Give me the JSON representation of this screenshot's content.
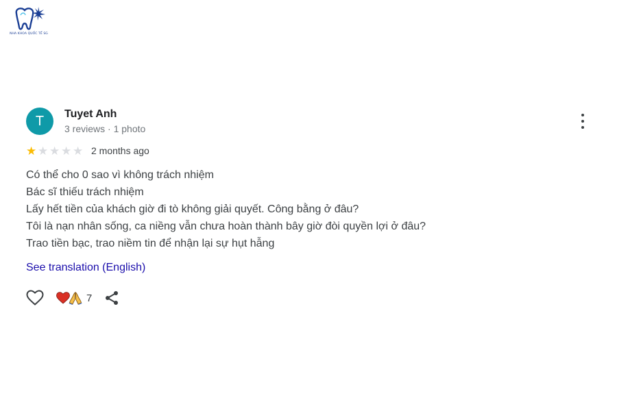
{
  "logo": {
    "text": "NHA KHOA QUỐC TẾ SG",
    "icon": "tooth-logo-icon"
  },
  "review": {
    "avatar_letter": "T",
    "author": "Tuyet Anh",
    "meta": "3 reviews · 1 photo",
    "rating": 1,
    "rating_max": 5,
    "time": "2 months ago",
    "lines": [
      "Có thể cho 0 sao vì không trách nhiệm",
      "Bác sĩ thiếu trách nhiệm",
      "Lấy hết tiền của khách giờ đi tò không giải quyết. Công bằng ở đâu?",
      "Tôi là nạn nhân sống, ca niềng vẫn chưa hoàn thành bây giờ đòi quyền lợi ở đâu?",
      "Trao tiền bạc, trao niềm tin để nhận lại sự hụt hẫng"
    ],
    "translate_link": "See translation (English)"
  },
  "actions": {
    "reaction_count": "7",
    "icons": [
      "heart-outline-icon",
      "red-heart-icon",
      "praying-hands-icon",
      "share-icon",
      "more-vert-icon"
    ]
  },
  "colors": {
    "avatar": "#0f9aa8",
    "star": "#fbbc04",
    "link": "#1a0dab"
  }
}
